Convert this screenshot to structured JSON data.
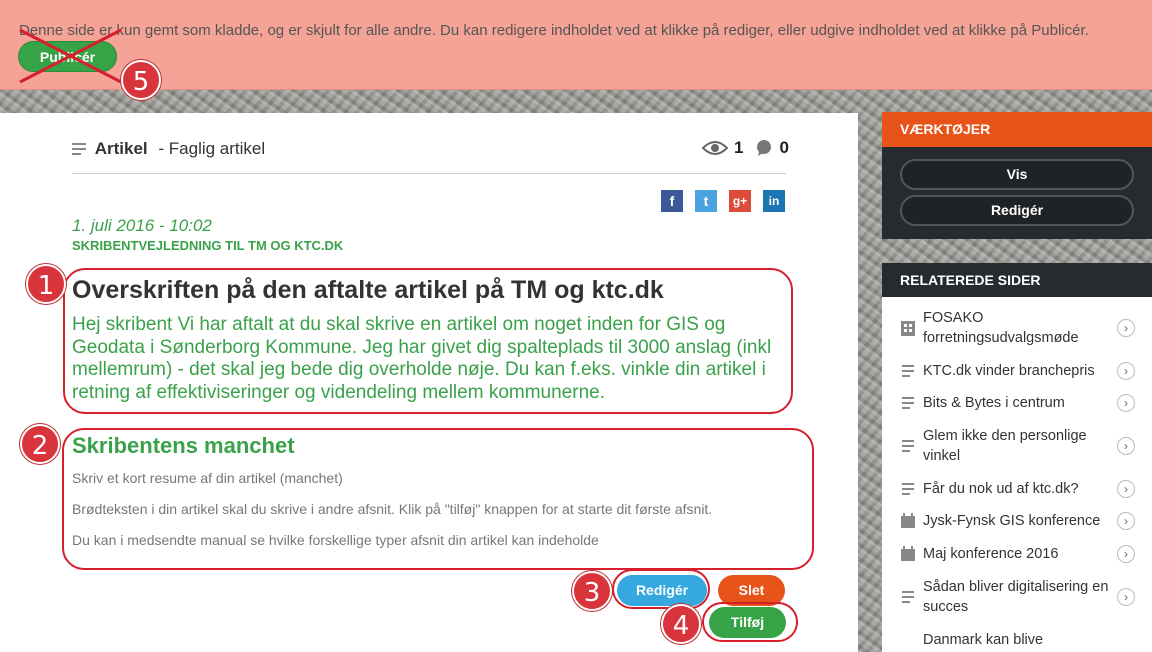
{
  "notice": {
    "text": "Denne side er kun gemt som kladde, og er skjult for alle andre. Du kan redigere indholdet ved at klikke på rediger, eller udgive indholdet ved at klikke på Publicér.",
    "publish_label": "Publicér"
  },
  "badges": [
    "1",
    "2",
    "3",
    "4",
    "5"
  ],
  "article": {
    "type_label": "Artikel",
    "type_detail": "- Faglig artikel",
    "views": "1",
    "comments": "0",
    "date": "1. juli 2016 - 10:02",
    "category": "SKRIBENTVEJLEDNING TIL TM OG KTC.DK",
    "headline": "Overskriften på den aftalte artikel på TM og ktc.dk",
    "lead": "Hej skribent Vi har aftalt at du skal skrive en artikel om noget inden for GIS og Geodata i Sønderborg Kommune. Jeg har givet dig spalteplads til 3000 anslag (inkl mellemrum) - det skal jeg bede dig overholde nøje. Du kan f.eks. vinkle din artikel i retning af effektiviseringer og videndeling mellem kommunerne.",
    "section_title": "Skribentens manchet",
    "section_paragraphs": [
      "Skriv et kort resume af din artikel (manchet)",
      "Brødteksten i din artikel skal du skrive i andre afsnit. Klik på \"tilføj\" knappen for at starte dit første afsnit.",
      "Du kan i medsendte manual se hvilke forskellige typer afsnit din artikel kan indeholde"
    ],
    "edit_label": "Redigér",
    "delete_label": "Slet",
    "add_label": "Tilføj"
  },
  "social": [
    "f",
    "t",
    "g+",
    "in"
  ],
  "tools": {
    "title": "VÆRKTØJER",
    "view_label": "Vis",
    "edit_label": "Redigér"
  },
  "related": {
    "title": "RELATEREDE SIDER",
    "items": [
      {
        "label": "FOSAKO forretningsudvalgsmøde",
        "icon": "building-icon"
      },
      {
        "label": "KTC.dk vinder branchepris",
        "icon": "article-icon"
      },
      {
        "label": "Bits & Bytes i centrum",
        "icon": "article-icon"
      },
      {
        "label": "Glem ikke den personlige vinkel",
        "icon": "article-icon"
      },
      {
        "label": "Får du nok ud af ktc.dk?",
        "icon": "article-icon"
      },
      {
        "label": "Jysk-Fynsk GIS konference",
        "icon": "calendar-icon"
      },
      {
        "label": "Maj konference 2016",
        "icon": "calendar-icon"
      },
      {
        "label": "Sådan bliver digitalisering en succes",
        "icon": "article-icon"
      },
      {
        "label": "Danmark kan blive",
        "icon": "none"
      }
    ]
  },
  "colors": {
    "accent_green": "#3aa14a",
    "notice_bg": "#f5a396",
    "tools_orange": "#e8531a",
    "annotation_red": "#d71f2b"
  }
}
